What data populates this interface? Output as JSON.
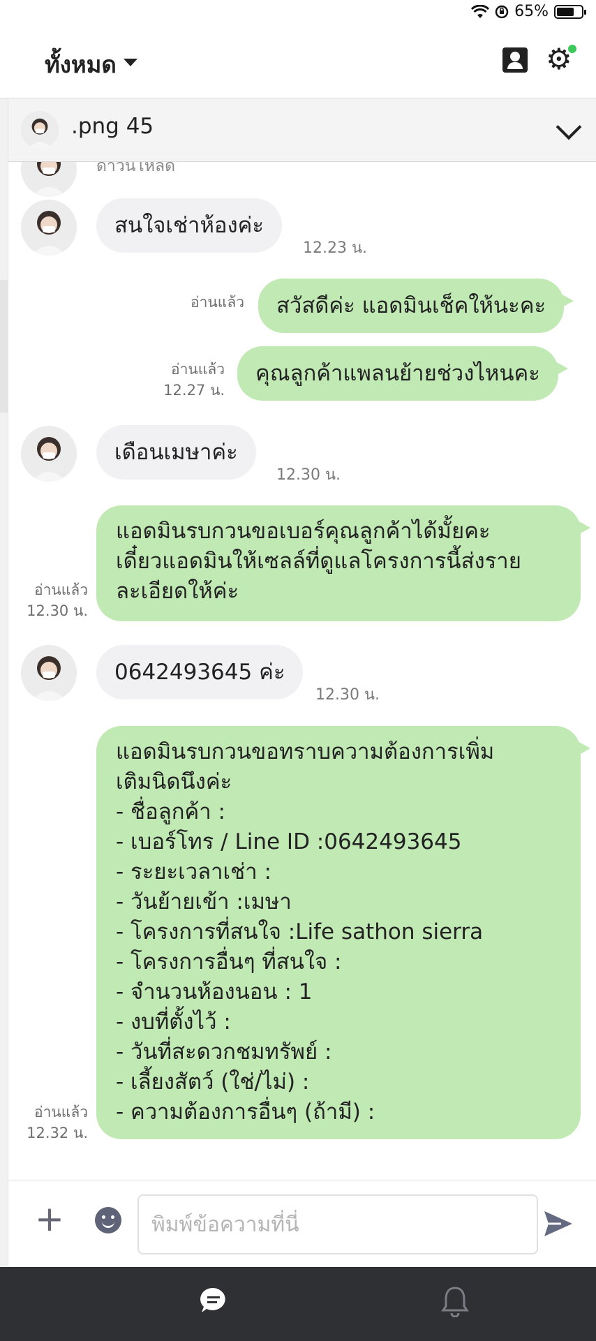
{
  "status_bar": {
    "battery": "65%",
    "battery_level": 0.65
  },
  "header": {
    "filter_label": "ทั้งหมด"
  },
  "chat": {
    "name": ".png 45",
    "peek_text": "ดาวนโหลด"
  },
  "messages": [
    {
      "dir": "in",
      "text": "สนใจเช่าห้องค่ะ",
      "time": "12.23 น."
    },
    {
      "dir": "out",
      "text": "สวัสดีค่ะ แอดมินเช็คให้นะคะ",
      "read": "อ่านแล้ว"
    },
    {
      "dir": "out",
      "text": "คุณลูกค้าแพลนย้ายช่วงไหนคะ",
      "read": "อ่านแล้ว",
      "time": "12.27 น."
    },
    {
      "dir": "in",
      "text": "เดือนเมษาค่ะ",
      "time": "12.30 น."
    },
    {
      "dir": "out",
      "text": "แอดมินรบกวนขอเบอร์คุณลูกค้าได้มั้ยคะ\nเดี๋ยวแอดมินให้เซลล์ที่ดูแลโครงการนี้ส่งราย\nละเอียดให้ค่ะ",
      "read": "อ่านแล้ว",
      "time": "12.30 น."
    },
    {
      "dir": "in",
      "text": "0642493645 ค่ะ",
      "time": "12.30 น."
    },
    {
      "dir": "out",
      "text": "แอดมินรบกวนขอทราบความต้องการเพิ่ม\nเติมนิดนึงค่ะ\n- ชื่อลูกค้า :\n- เบอร์โทร / Line ID :0642493645\n- ระยะเวลาเช่า :\n- วันย้ายเข้า :เมษา\n- โครงการที่สนใจ :Life sathon sierra\n- โครงการอื่นๆ ที่สนใจ :\n- จำนวนห้องนอน : 1\n- งบที่ตั้งไว้ :\n- วันที่สะดวกชมทรัพย์ :\n- เลี้ยงสัตว์ (ใช่/ไม่) :\n- ความต้องการอื่นๆ (ถ้ามี) :",
      "read": "อ่านแล้ว",
      "time": "12.32 น."
    }
  ],
  "composer": {
    "placeholder": "พิมพ์ข้อความที่นี่"
  },
  "icons": {
    "wifi": "wifi-icon",
    "lock_rotation": "rotation-lock-icon",
    "battery": "battery-icon",
    "contact": "contact-icon",
    "settings": "gear-icon",
    "chevron": "chevron-down-icon",
    "plus": "plus-icon",
    "emoji": "emoji-icon",
    "send": "send-icon",
    "nav_chat": "chat-icon",
    "nav_bell": "bell-icon"
  },
  "colors": {
    "bubble_out": "#c1e9b4",
    "bubble_in": "#f1f1f3",
    "nav_bg": "#2f3034",
    "notify_dot": "#3cc95b"
  }
}
